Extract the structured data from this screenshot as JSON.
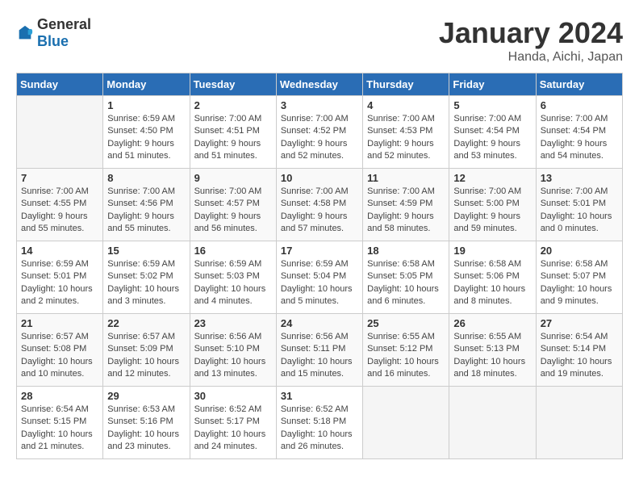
{
  "header": {
    "logo_general": "General",
    "logo_blue": "Blue",
    "month": "January 2024",
    "location": "Handa, Aichi, Japan"
  },
  "days_of_week": [
    "Sunday",
    "Monday",
    "Tuesday",
    "Wednesday",
    "Thursday",
    "Friday",
    "Saturday"
  ],
  "weeks": [
    [
      {
        "day": "",
        "info": ""
      },
      {
        "day": "1",
        "info": "Sunrise: 6:59 AM\nSunset: 4:50 PM\nDaylight: 9 hours\nand 51 minutes."
      },
      {
        "day": "2",
        "info": "Sunrise: 7:00 AM\nSunset: 4:51 PM\nDaylight: 9 hours\nand 51 minutes."
      },
      {
        "day": "3",
        "info": "Sunrise: 7:00 AM\nSunset: 4:52 PM\nDaylight: 9 hours\nand 52 minutes."
      },
      {
        "day": "4",
        "info": "Sunrise: 7:00 AM\nSunset: 4:53 PM\nDaylight: 9 hours\nand 52 minutes."
      },
      {
        "day": "5",
        "info": "Sunrise: 7:00 AM\nSunset: 4:54 PM\nDaylight: 9 hours\nand 53 minutes."
      },
      {
        "day": "6",
        "info": "Sunrise: 7:00 AM\nSunset: 4:54 PM\nDaylight: 9 hours\nand 54 minutes."
      }
    ],
    [
      {
        "day": "7",
        "info": "Sunrise: 7:00 AM\nSunset: 4:55 PM\nDaylight: 9 hours\nand 55 minutes."
      },
      {
        "day": "8",
        "info": "Sunrise: 7:00 AM\nSunset: 4:56 PM\nDaylight: 9 hours\nand 55 minutes."
      },
      {
        "day": "9",
        "info": "Sunrise: 7:00 AM\nSunset: 4:57 PM\nDaylight: 9 hours\nand 56 minutes."
      },
      {
        "day": "10",
        "info": "Sunrise: 7:00 AM\nSunset: 4:58 PM\nDaylight: 9 hours\nand 57 minutes."
      },
      {
        "day": "11",
        "info": "Sunrise: 7:00 AM\nSunset: 4:59 PM\nDaylight: 9 hours\nand 58 minutes."
      },
      {
        "day": "12",
        "info": "Sunrise: 7:00 AM\nSunset: 5:00 PM\nDaylight: 9 hours\nand 59 minutes."
      },
      {
        "day": "13",
        "info": "Sunrise: 7:00 AM\nSunset: 5:01 PM\nDaylight: 10 hours\nand 0 minutes."
      }
    ],
    [
      {
        "day": "14",
        "info": "Sunrise: 6:59 AM\nSunset: 5:01 PM\nDaylight: 10 hours\nand 2 minutes."
      },
      {
        "day": "15",
        "info": "Sunrise: 6:59 AM\nSunset: 5:02 PM\nDaylight: 10 hours\nand 3 minutes."
      },
      {
        "day": "16",
        "info": "Sunrise: 6:59 AM\nSunset: 5:03 PM\nDaylight: 10 hours\nand 4 minutes."
      },
      {
        "day": "17",
        "info": "Sunrise: 6:59 AM\nSunset: 5:04 PM\nDaylight: 10 hours\nand 5 minutes."
      },
      {
        "day": "18",
        "info": "Sunrise: 6:58 AM\nSunset: 5:05 PM\nDaylight: 10 hours\nand 6 minutes."
      },
      {
        "day": "19",
        "info": "Sunrise: 6:58 AM\nSunset: 5:06 PM\nDaylight: 10 hours\nand 8 minutes."
      },
      {
        "day": "20",
        "info": "Sunrise: 6:58 AM\nSunset: 5:07 PM\nDaylight: 10 hours\nand 9 minutes."
      }
    ],
    [
      {
        "day": "21",
        "info": "Sunrise: 6:57 AM\nSunset: 5:08 PM\nDaylight: 10 hours\nand 10 minutes."
      },
      {
        "day": "22",
        "info": "Sunrise: 6:57 AM\nSunset: 5:09 PM\nDaylight: 10 hours\nand 12 minutes."
      },
      {
        "day": "23",
        "info": "Sunrise: 6:56 AM\nSunset: 5:10 PM\nDaylight: 10 hours\nand 13 minutes."
      },
      {
        "day": "24",
        "info": "Sunrise: 6:56 AM\nSunset: 5:11 PM\nDaylight: 10 hours\nand 15 minutes."
      },
      {
        "day": "25",
        "info": "Sunrise: 6:55 AM\nSunset: 5:12 PM\nDaylight: 10 hours\nand 16 minutes."
      },
      {
        "day": "26",
        "info": "Sunrise: 6:55 AM\nSunset: 5:13 PM\nDaylight: 10 hours\nand 18 minutes."
      },
      {
        "day": "27",
        "info": "Sunrise: 6:54 AM\nSunset: 5:14 PM\nDaylight: 10 hours\nand 19 minutes."
      }
    ],
    [
      {
        "day": "28",
        "info": "Sunrise: 6:54 AM\nSunset: 5:15 PM\nDaylight: 10 hours\nand 21 minutes."
      },
      {
        "day": "29",
        "info": "Sunrise: 6:53 AM\nSunset: 5:16 PM\nDaylight: 10 hours\nand 23 minutes."
      },
      {
        "day": "30",
        "info": "Sunrise: 6:52 AM\nSunset: 5:17 PM\nDaylight: 10 hours\nand 24 minutes."
      },
      {
        "day": "31",
        "info": "Sunrise: 6:52 AM\nSunset: 5:18 PM\nDaylight: 10 hours\nand 26 minutes."
      },
      {
        "day": "",
        "info": ""
      },
      {
        "day": "",
        "info": ""
      },
      {
        "day": "",
        "info": ""
      }
    ]
  ]
}
